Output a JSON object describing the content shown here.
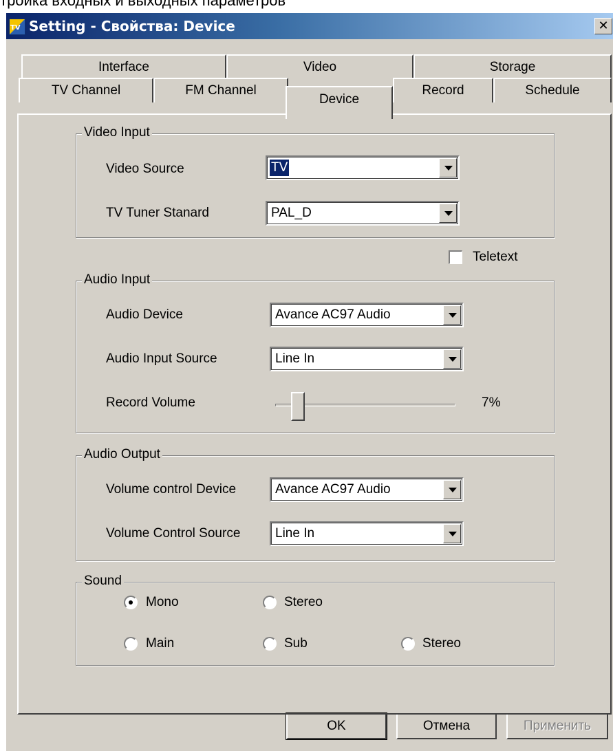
{
  "caption": "тройка входных и выходных параметров",
  "window": {
    "icon_text": "TV",
    "title": "Setting - Свойства: Device",
    "close_label": "✕"
  },
  "tabs": {
    "row1": [
      {
        "label": "Interface"
      },
      {
        "label": "Video"
      },
      {
        "label": "Storage"
      }
    ],
    "row2": [
      {
        "label": "TV Channel"
      },
      {
        "label": "FM Channel"
      },
      {
        "label": "Device"
      },
      {
        "label": "Record"
      },
      {
        "label": "Schedule"
      }
    ],
    "active": "Device"
  },
  "video_input": {
    "title": "Video Input",
    "video_source_label": "Video Source",
    "video_source_value": "TV",
    "tuner_label": "TV Tuner Stanard",
    "tuner_value": "PAL_D"
  },
  "teletext": {
    "label": "Teletext",
    "checked": false
  },
  "audio_input": {
    "title": "Audio Input",
    "device_label": "Audio Device",
    "device_value": "Avance AC97 Audio",
    "source_label": "Audio Input Source",
    "source_value": "Line In",
    "volume_label": "Record Volume",
    "volume_value": "7%",
    "volume_level": 0.07
  },
  "audio_output": {
    "title": "Audio Output",
    "device_label": "Volume control Device",
    "device_value": "Avance AC97 Audio",
    "source_label": "Volume Control Source",
    "source_value": "Line In"
  },
  "sound": {
    "title": "Sound",
    "row1": [
      {
        "label": "Mono",
        "checked": true
      },
      {
        "label": "Stereo",
        "checked": false
      }
    ],
    "row2": [
      {
        "label": "Main",
        "checked": false
      },
      {
        "label": "Sub",
        "checked": false
      },
      {
        "label": "Stereo",
        "checked": false
      }
    ]
  },
  "buttons": {
    "ok": "OK",
    "cancel": "Отмена",
    "apply": "Применить"
  }
}
